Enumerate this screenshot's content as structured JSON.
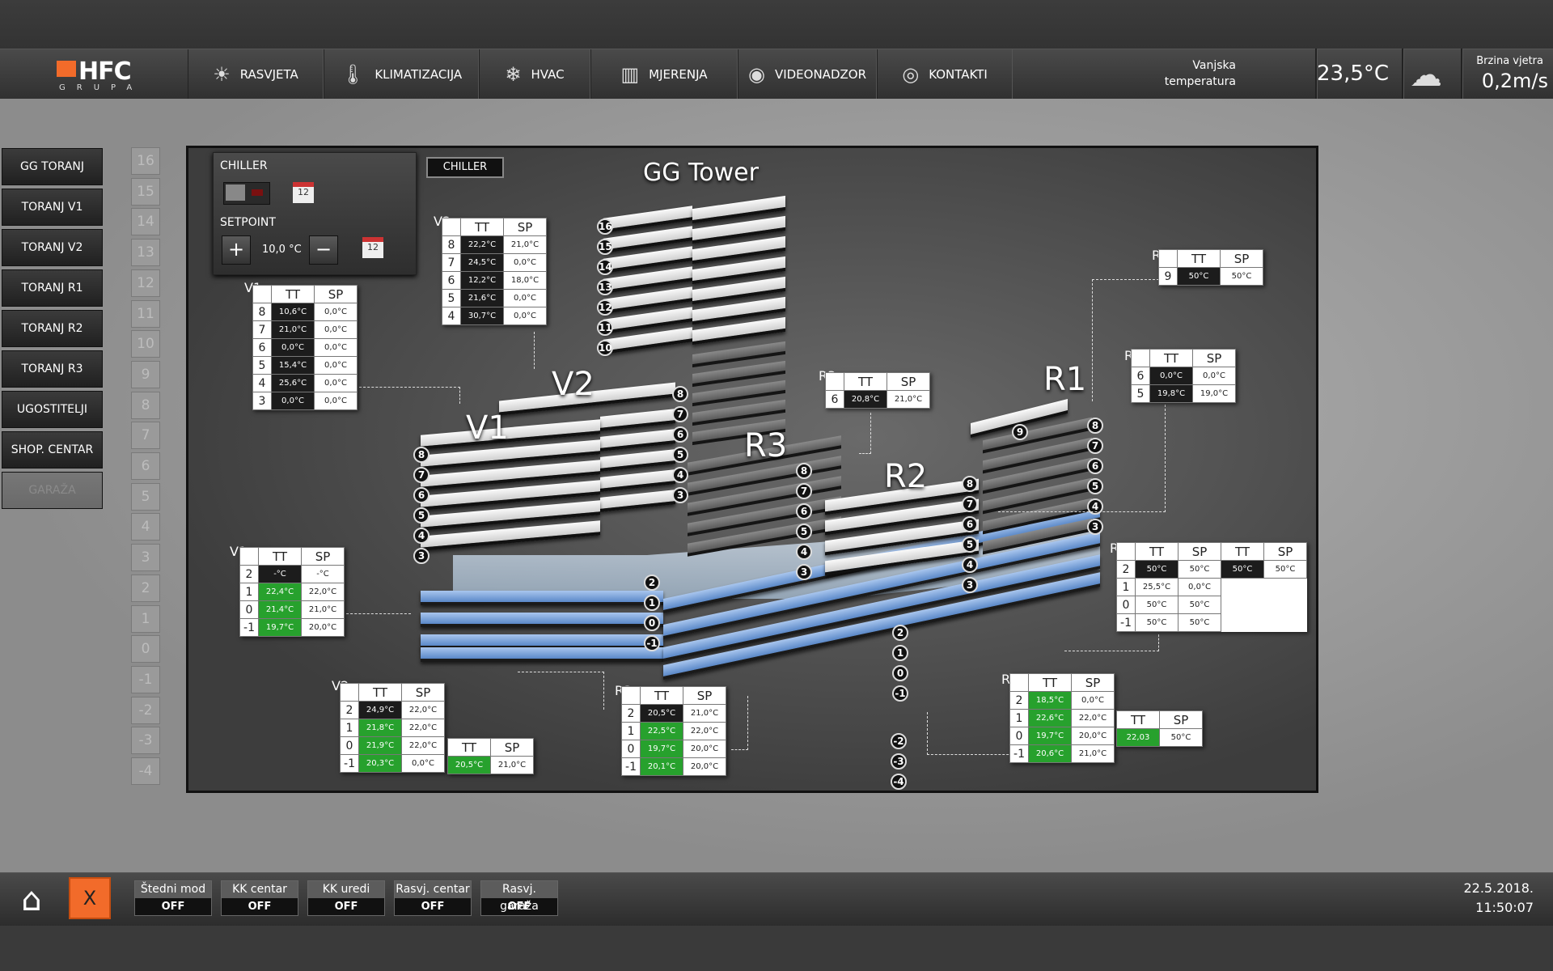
{
  "brand": {
    "logo": "HFC",
    "logo_sub": "GRUPA"
  },
  "nav": [
    {
      "label": "RASVJETA",
      "icon": "bulb-icon"
    },
    {
      "label": "KLIMATIZACIJA",
      "icon": "thermometer-icon",
      "active": true
    },
    {
      "label": "HVAC",
      "icon": "snowflake-sun-icon"
    },
    {
      "label": "MJERENJA",
      "icon": "bar-chart-icon"
    },
    {
      "label": "VIDEONADZOR",
      "icon": "eye-icon"
    },
    {
      "label": "KONTAKTI",
      "icon": "lifebuoy-icon"
    }
  ],
  "weather": {
    "outside_label_1": "Vanjska",
    "outside_label_2": "temperatura",
    "outside_temp": "23,5°C",
    "wind_label": "Brzina vjetra",
    "wind_value": "0,2m/s",
    "icon": "cloud-sun-icon"
  },
  "sidebar": [
    "GG TORANJ",
    "TORANJ V1",
    "TORANJ V2",
    "TORANJ R1",
    "TORANJ R2",
    "TORANJ R3",
    "UGOSTITELJI",
    "SHOP. CENTAR",
    "GARAŽA"
  ],
  "floor_index": [
    "16",
    "15",
    "14",
    "13",
    "12",
    "11",
    "10",
    "9",
    "8",
    "7",
    "6",
    "5",
    "4",
    "3",
    "2",
    "1",
    "0",
    "-1",
    "-2",
    "-3",
    "-4"
  ],
  "chiller": {
    "title": "CHILLER",
    "setpoint_label": "SETPOINT",
    "setpoint_value": "10,0 °C",
    "plus": "+",
    "minus": "−",
    "tag": "CHILLER",
    "cal": "12"
  },
  "buildings": {
    "gg": "GG Tower",
    "v1": "V1",
    "v2": "V2",
    "r1": "R1",
    "r2": "R2",
    "r3": "R3"
  },
  "badges": {
    "gg": [
      "16",
      "15",
      "14",
      "13",
      "12",
      "11",
      "10"
    ],
    "v1": [
      "8",
      "7",
      "6",
      "5",
      "4",
      "3"
    ],
    "v2": [
      "8",
      "7",
      "6",
      "5",
      "4",
      "3"
    ],
    "podium": [
      "2",
      "1",
      "0",
      "-1"
    ],
    "r3": [
      "8",
      "7",
      "6",
      "5",
      "4",
      "3"
    ],
    "r2": [
      "8",
      "7",
      "6",
      "5",
      "4",
      "3"
    ],
    "r1": [
      "8",
      "7",
      "6",
      "5",
      "4",
      "3"
    ],
    "r1_top": "9",
    "right": [
      "2",
      "1",
      "0",
      "-1"
    ],
    "garage": [
      "-2",
      "-3",
      "-4"
    ]
  },
  "headers": {
    "tt": "TT",
    "sp": "SP"
  },
  "tables": {
    "v1_top": {
      "label": "V1",
      "rows": [
        [
          "8",
          "10,6°C",
          "0,0°C"
        ],
        [
          "7",
          "21,0°C",
          "0,0°C"
        ],
        [
          "6",
          "0,0°C",
          "0,0°C"
        ],
        [
          "5",
          "15,4°C",
          "0,0°C"
        ],
        [
          "4",
          "25,6°C",
          "0,0°C"
        ],
        [
          "3",
          "0,0°C",
          "0,0°C"
        ]
      ]
    },
    "v2_top": {
      "label": "V2",
      "rows": [
        [
          "8",
          "22,2°C",
          "21,0°C"
        ],
        [
          "7",
          "24,5°C",
          "0,0°C"
        ],
        [
          "6",
          "12,2°C",
          "18,0°C"
        ],
        [
          "5",
          "21,6°C",
          "0,0°C"
        ],
        [
          "4",
          "30,7°C",
          "0,0°C"
        ]
      ]
    },
    "r1_top": {
      "label": "R1",
      "rows": [
        [
          "9",
          "50°C",
          "50°C"
        ]
      ]
    },
    "r2_top": {
      "label": "R2",
      "rows": [
        [
          "6",
          "0,0°C",
          "0,0°C"
        ],
        [
          "5",
          "19,8°C",
          "19,0°C"
        ]
      ]
    },
    "r3_top": {
      "label": "R3",
      "rows": [
        [
          "6",
          "20,8°C",
          "21,0°C"
        ]
      ]
    },
    "v1_low": {
      "label": "V1",
      "rows": [
        [
          "2",
          "-°C",
          "-°C"
        ],
        [
          "1",
          "22,4°C",
          "22,0°C"
        ],
        [
          "0",
          "21,4°C",
          "21,0°C"
        ],
        [
          "-1",
          "19,7°C",
          "20,0°C"
        ]
      ]
    },
    "v2_low": {
      "label": "V2",
      "rows": [
        [
          "2",
          "24,9°C",
          "22,0°C"
        ],
        [
          "1",
          "21,8°C",
          "22,0°C"
        ],
        [
          "0",
          "21,9°C",
          "22,0°C"
        ],
        [
          "-1",
          "20,3°C",
          "0,0°C"
        ]
      ],
      "extra": [
        "20,5°C",
        "21,0°C"
      ]
    },
    "r3_low": {
      "label": "R3",
      "rows": [
        [
          "2",
          "20,5°C",
          "21,0°C"
        ],
        [
          "1",
          "22,5°C",
          "22,0°C"
        ],
        [
          "0",
          "19,7°C",
          "20,0°C"
        ],
        [
          "-1",
          "20,1°C",
          "20,0°C"
        ]
      ]
    },
    "r1_low": {
      "label": "R1",
      "rows": [
        [
          "2",
          "50°C",
          "50°C"
        ],
        [
          "1",
          "25,5°C",
          "0,0°C"
        ],
        [
          "0",
          "50°C",
          "50°C"
        ],
        [
          "-1",
          "50°C",
          "50°C"
        ]
      ],
      "extra": [
        "50°C",
        "50°C"
      ]
    },
    "r2_low": {
      "label": "R2",
      "rows": [
        [
          "2",
          "18,5°C",
          "0,0°C"
        ],
        [
          "1",
          "22,6°C",
          "22,0°C"
        ],
        [
          "0",
          "19,7°C",
          "20,0°C"
        ],
        [
          "-1",
          "20,6°C",
          "21,0°C"
        ]
      ],
      "extra": [
        "22,03",
        "50°C"
      ]
    }
  },
  "bottom": {
    "home_icon": "home-icon",
    "close": "X",
    "toggles": [
      {
        "label": "Štedni mod",
        "value": "OFF"
      },
      {
        "label": "KK centar",
        "value": "OFF"
      },
      {
        "label": "KK uredi",
        "value": "OFF"
      },
      {
        "label": "Rasvj. centar",
        "value": "OFF"
      },
      {
        "label": "Rasvj. garaža",
        "value": "OFF"
      }
    ],
    "date": "22.5.2018.",
    "time": "11:50:07"
  },
  "colors": {
    "accent": "#f26b2a",
    "active_green": "#27a12d",
    "podium_blue": "#5a88c8"
  }
}
